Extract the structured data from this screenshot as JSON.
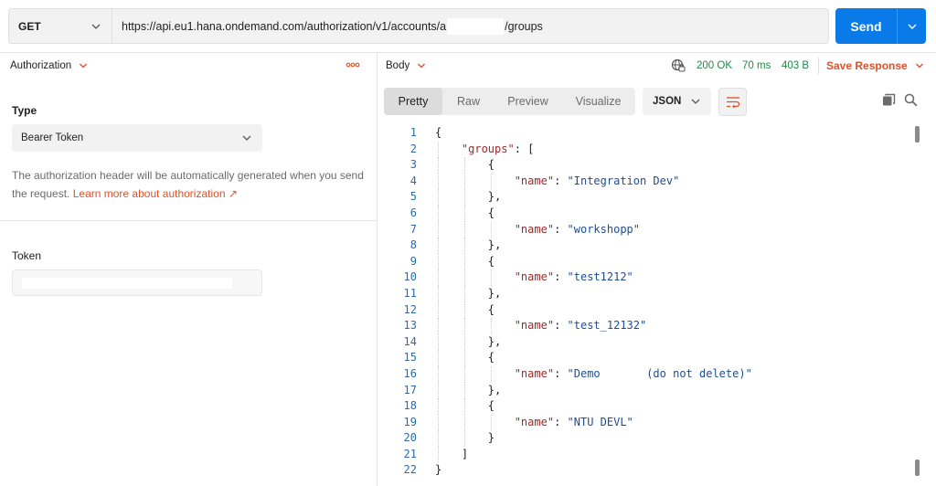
{
  "request": {
    "method": "GET",
    "url_prefix": "https://api.eu1.hana.ondemand.com/authorization/v1/accounts/a",
    "url_suffix": "/groups",
    "send_label": "Send"
  },
  "auth": {
    "tab_label": "Authorization",
    "type_heading": "Type",
    "type_value": "Bearer Token",
    "help_text": "The authorization header will be automatically generated when you send the request. ",
    "help_link": "Learn more about authorization ↗",
    "token_label": "Token"
  },
  "response": {
    "body_tab": "Body",
    "status": "200 OK",
    "time": "70 ms",
    "size": "403 B",
    "save_label": "Save Response",
    "view_tabs": [
      "Pretty",
      "Raw",
      "Preview",
      "Visualize"
    ],
    "active_view": "Pretty",
    "format": "JSON",
    "lines": [
      "{",
      "    \"groups\": [",
      "        {",
      "            \"name\": \"Integration Dev\"",
      "        },",
      "        {",
      "            \"name\": \"workshopp\"",
      "        },",
      "        {",
      "            \"name\": \"test1212\"",
      "        },",
      "        {",
      "            \"name\": \"test_12132\"",
      "        },",
      "        {",
      "            \"name\": \"Demo       (do not delete)\"",
      "        },",
      "        {",
      "            \"name\": \"NTU DEVL\"",
      "        }",
      "    ]",
      "}"
    ]
  },
  "colors": {
    "accent": "#0a7ae8",
    "orange": "#d9532c",
    "status_green": "#1e8a47",
    "json_key": "#9d2a2a",
    "json_string": "#1f4d8f"
  }
}
